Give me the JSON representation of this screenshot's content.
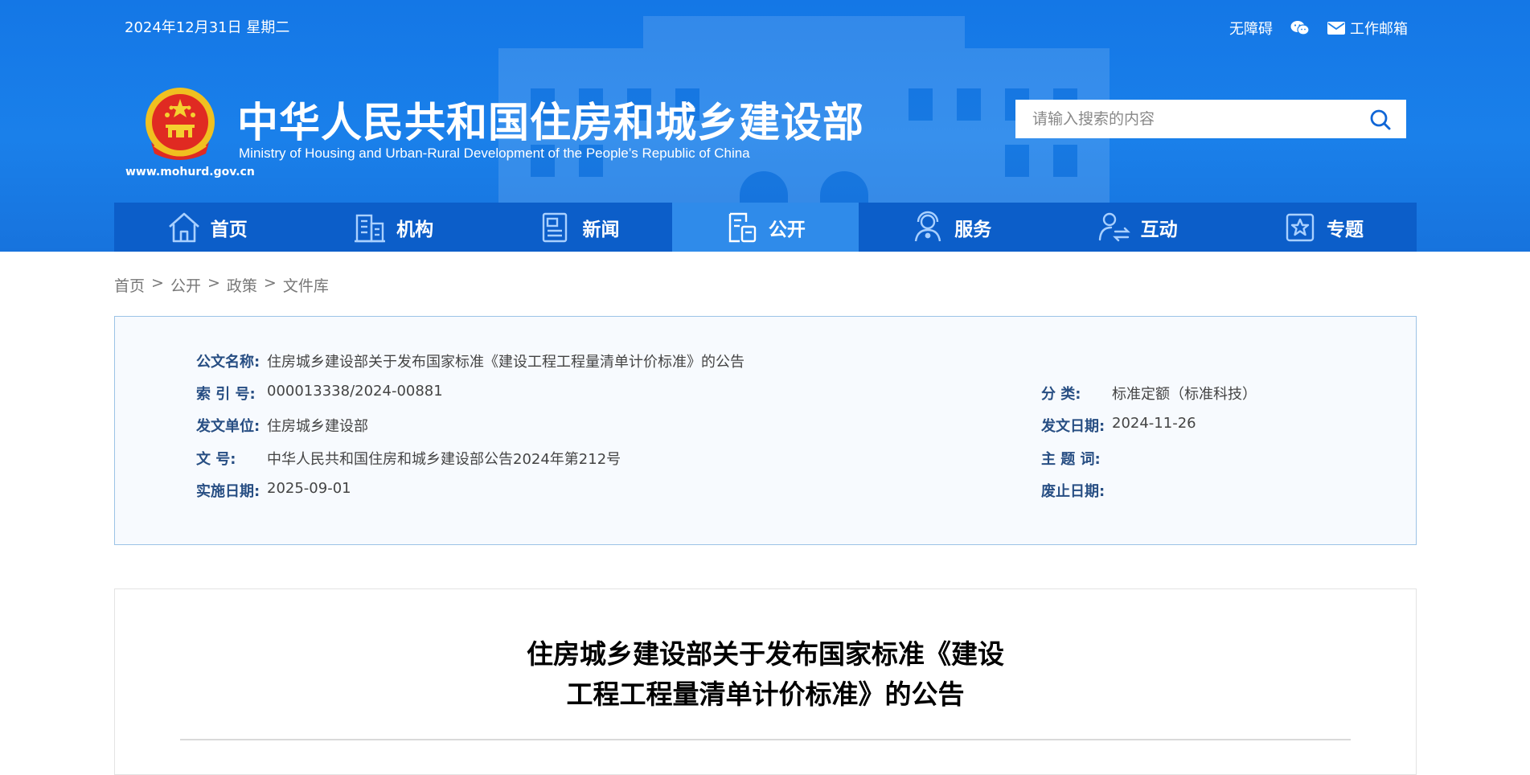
{
  "header": {
    "date": "2024年12月31日 星期二",
    "accessibility_link": "无障碍",
    "mail_link": "工作邮箱",
    "site_title": "中华人民共和国住房和城乡建设部",
    "site_subtitle": "Ministry of Housing and Urban-Rural Development of the People’s Republic of China",
    "site_url": "www.mohurd.gov.cn",
    "search_placeholder": "请输入搜索的内容"
  },
  "nav": {
    "items": [
      {
        "label": "首页",
        "icon": "home-icon"
      },
      {
        "label": "机构",
        "icon": "building-icon"
      },
      {
        "label": "新闻",
        "icon": "news-icon"
      },
      {
        "label": "公开",
        "icon": "document-icon",
        "active": true
      },
      {
        "label": "服务",
        "icon": "service-icon"
      },
      {
        "label": "互动",
        "icon": "interaction-icon"
      },
      {
        "label": "专题",
        "icon": "topic-star-icon"
      }
    ]
  },
  "breadcrumb": {
    "items": [
      "首页",
      "公开",
      "政策",
      "文件库"
    ],
    "separator": ">"
  },
  "doc_info": {
    "name_label": "公文名称:",
    "name_value": "住房城乡建设部关于发布国家标准《建设工程工程量清单计价标准》的公告",
    "index_label": "索 引 号:",
    "index_value": "000013338/2024-00881",
    "category_label": "分 类:",
    "category_value": "标准定额（标准科技）",
    "issuer_label": "发文单位:",
    "issuer_value": "住房城乡建设部",
    "issue_date_label": "发文日期:",
    "issue_date_value": "2024-11-26",
    "doc_no_label": "文 号:",
    "doc_no_value": "中华人民共和国住房和城乡建设部公告2024年第212号",
    "keywords_label": "主 题 词:",
    "keywords_value": "",
    "effective_label": "实施日期:",
    "effective_value": "2025-09-01",
    "expire_label": "废止日期:",
    "expire_value": ""
  },
  "article": {
    "title_line1": "住房城乡建设部关于发布国家标准《建设",
    "title_line2": "工程工程量清单计价标准》的公告"
  },
  "colors": {
    "header_blue": "#1a80ea",
    "nav_blue": "#0c5ec9",
    "nav_active": "#2f8bea",
    "label_blue": "#274e83",
    "panel_bg": "#f7fafe"
  }
}
